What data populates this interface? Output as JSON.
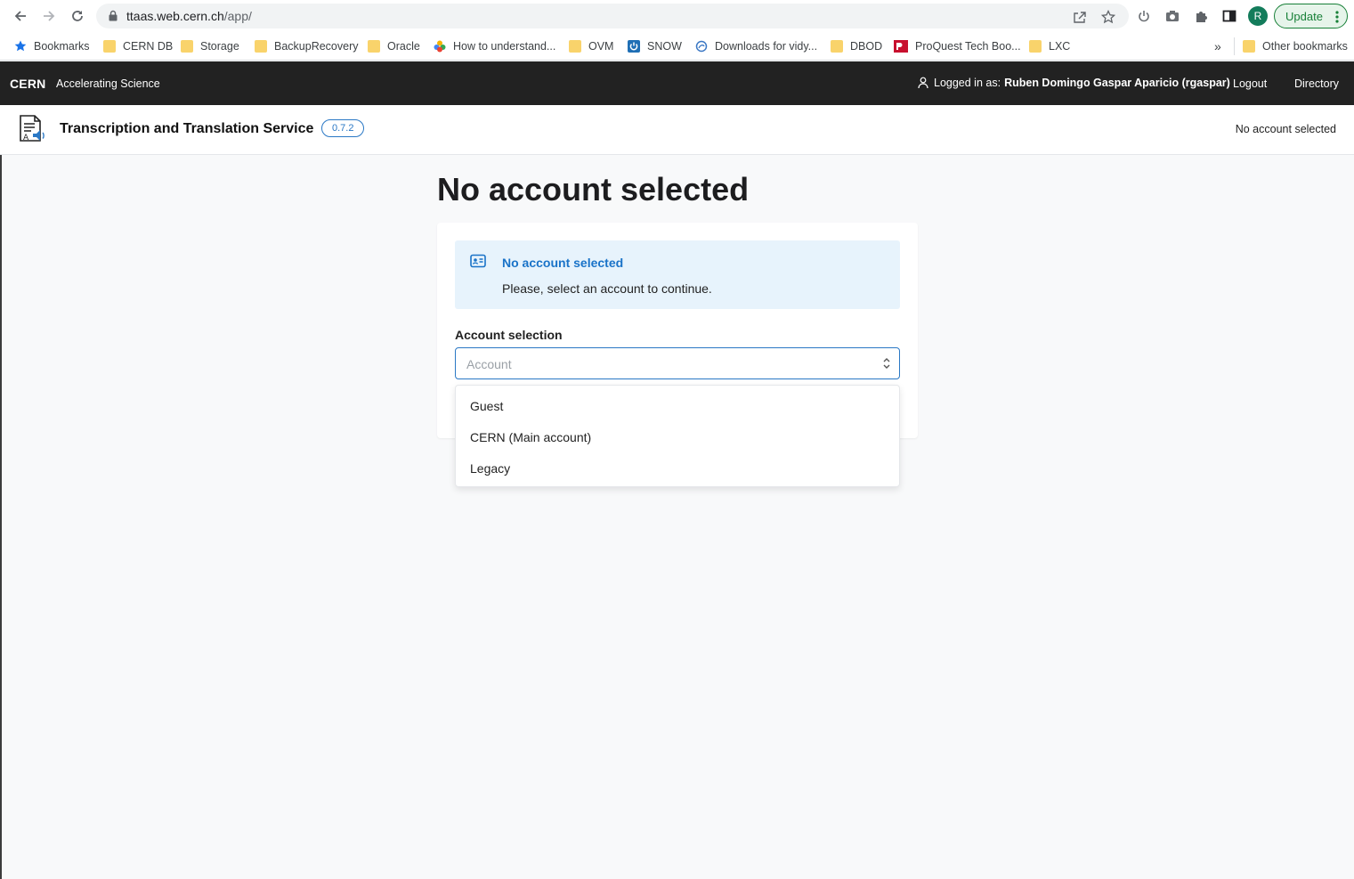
{
  "browser": {
    "url_host": "ttaas.web.cern.ch",
    "url_path": "/app/",
    "profile_initial": "R",
    "update_label": "Update"
  },
  "bookmarks": {
    "items": [
      {
        "label": "Bookmarks",
        "icon": "star-icon"
      },
      {
        "label": "CERN DB",
        "icon": "folder-icon"
      },
      {
        "label": "Storage",
        "icon": "folder-icon"
      },
      {
        "label": "BackupRecovery",
        "icon": "folder-icon"
      },
      {
        "label": "Oracle",
        "icon": "folder-icon"
      },
      {
        "label": "How to understand...",
        "icon": "flower-icon"
      },
      {
        "label": "OVM",
        "icon": "folder-icon"
      },
      {
        "label": "SNOW",
        "icon": "power-icon"
      },
      {
        "label": "Downloads for vidy...",
        "icon": "swirl-icon"
      },
      {
        "label": "DBOD",
        "icon": "folder-icon"
      },
      {
        "label": "ProQuest Tech Boo...",
        "icon": "proquest-icon"
      },
      {
        "label": "LXC",
        "icon": "folder-icon"
      }
    ],
    "overflow": "»",
    "other": "Other bookmarks"
  },
  "cern_toolbar": {
    "logo": "CERN",
    "tagline": "Accelerating Science",
    "logged_in_prefix": "Logged in as:",
    "user": "Ruben Domingo Gaspar Aparicio (rgaspar)",
    "logout": "Logout",
    "directory": "Directory"
  },
  "app_header": {
    "title": "Transcription and Translation Service",
    "version": "0.7.2",
    "account_status": "No account selected"
  },
  "main": {
    "page_title": "No account selected",
    "alert": {
      "heading": "No account selected",
      "message": "Please, select an account to continue."
    },
    "account_selection": {
      "label": "Account selection",
      "placeholder": "Account",
      "options": [
        "Guest",
        "CERN (Main account)",
        "Legacy"
      ]
    }
  },
  "colors": {
    "accent": "#2a78c5",
    "cern_bar": "#222222",
    "alert_bg": "#e7f3fc",
    "update_green": "#188038"
  }
}
